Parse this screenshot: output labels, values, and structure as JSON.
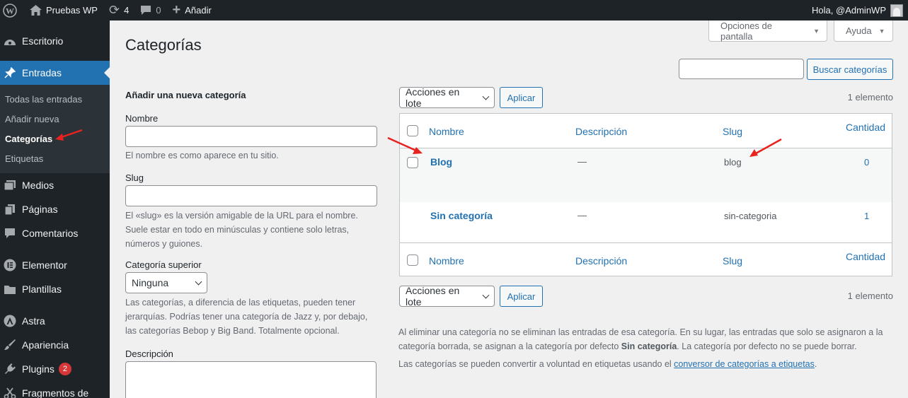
{
  "admin_bar": {
    "site_name": "Pruebas WP",
    "updates_count": "4",
    "comments_count": "0",
    "new_label": "Añadir",
    "greeting": "Hola, @AdminWP"
  },
  "sidebar": {
    "items": [
      {
        "label": "Escritorio",
        "icon": "dashboard-icon"
      },
      {
        "label": "Entradas",
        "icon": "pin-icon"
      },
      {
        "label": "Medios",
        "icon": "media-icon"
      },
      {
        "label": "Páginas",
        "icon": "pages-icon"
      },
      {
        "label": "Comentarios",
        "icon": "comment-icon"
      },
      {
        "label": "Elementor",
        "icon": "elementor-icon"
      },
      {
        "label": "Plantillas",
        "icon": "folder-icon"
      },
      {
        "label": "Astra",
        "icon": "astra-icon"
      },
      {
        "label": "Apariencia",
        "icon": "brush-icon"
      },
      {
        "label": "Plugins",
        "icon": "plugin-icon",
        "badge": "2"
      },
      {
        "label": "Fragmentos de",
        "icon": "scissors-icon"
      }
    ],
    "submenu": [
      "Todas las entradas",
      "Añadir nueva",
      "Categorías",
      "Etiquetas"
    ]
  },
  "screen_options_label": "Opciones de pantalla",
  "help_label": "Ayuda",
  "page_title": "Categorías",
  "search_button": "Buscar categorías",
  "form": {
    "heading": "Añadir una nueva categoría",
    "name_label": "Nombre",
    "name_help": "El nombre es como aparece en tu sitio.",
    "slug_label": "Slug",
    "slug_help_1": "El «slug» es la versión amigable de la URL para el nombre.",
    "slug_help_2": "Suele estar en todo en minúsculas y contiene solo letras,",
    "slug_help_3": "números y guiones.",
    "parent_label": "Categoría superior",
    "parent_value": "Ninguna",
    "parent_help_1": "Las categorías, a diferencia de las etiquetas, pueden tener",
    "parent_help_2": "jerarquías. Podrías tener una categoría de Jazz y, por debajo,",
    "parent_help_3": "las categorías Bebop y Big Band. Totalmente opcional.",
    "description_label": "Descripción"
  },
  "bulk": {
    "action_label": "Acciones en lote",
    "apply_label": "Aplicar",
    "count_text": "1 elemento"
  },
  "table": {
    "headers": {
      "name": "Nombre",
      "description": "Descripción",
      "slug": "Slug",
      "count": "Cantidad"
    },
    "rows": [
      {
        "name": "Blog",
        "description": "—",
        "slug": "blog",
        "count": "0"
      },
      {
        "name": "Sin categoría",
        "description": "—",
        "slug": "sin-categoria",
        "count": "1"
      }
    ]
  },
  "notes": {
    "p1_a": "Al eliminar una categoría no se eliminan las entradas de esa categoría. En su lugar, las entradas que solo se asignaron a la",
    "p1_b": "categoría borrada, se asignan a la categoría por defecto ",
    "p1_bold": "Sin categoría",
    "p1_c": ". La categoría por defecto no se puede borrar.",
    "p2_a": "Las categorías se pueden convertir a voluntad en etiquetas usando el ",
    "p2_link": "conversor de categorías a etiquetas",
    "p2_b": "."
  },
  "colors": {
    "accent": "#2271b1",
    "adminbar": "#1d2327",
    "annotation_arrow": "#e8221e"
  }
}
